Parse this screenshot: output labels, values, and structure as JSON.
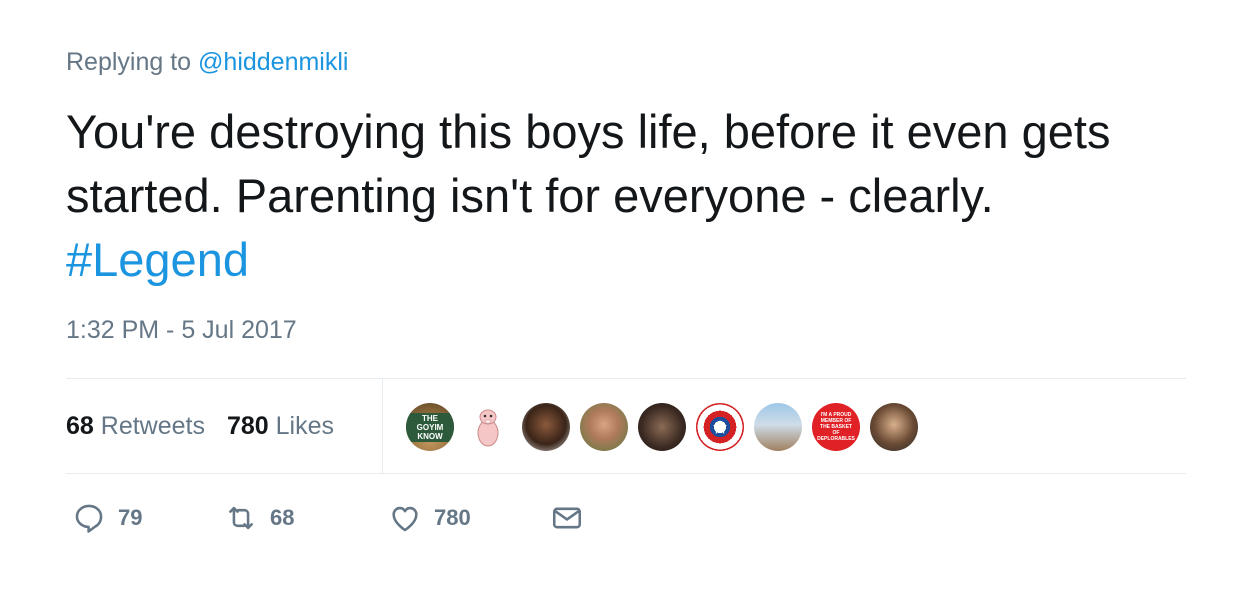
{
  "reply": {
    "prefix": "Replying to",
    "handle": "@hiddenmikli"
  },
  "tweet": {
    "text": "You're destroying this boys life, before it even gets started. Parenting isn't for everyone - clearly.",
    "hashtag": "#Legend"
  },
  "timestamp": "1:32 PM - 5 Jul 2017",
  "stats": {
    "retweets_count": "68",
    "retweets_label": "Retweets",
    "likes_count": "780",
    "likes_label": "Likes"
  },
  "avatars": [
    {
      "text": "THE GOYIM KNOW"
    },
    {
      "icon": "cartoon-mole-rat-icon"
    },
    {
      "icon": "person-photo"
    },
    {
      "icon": "person-photo"
    },
    {
      "icon": "person-photo"
    },
    {
      "icon": "captain-america-shield-icon"
    },
    {
      "icon": "scenic-photo"
    },
    {
      "text": "I'M A PROUD MEMBER OF THE BASKET OF DEPLORABLES"
    },
    {
      "icon": "person-photo"
    }
  ],
  "actions": {
    "reply_count": "79",
    "retweet_count": "68",
    "like_count": "780",
    "icons": [
      "reply-icon",
      "retweet-icon",
      "heart-icon",
      "envelope-icon"
    ]
  },
  "colors": {
    "link": "#1b95e0",
    "muted": "#657786",
    "text": "#14171a",
    "border": "#e6ecf0"
  }
}
